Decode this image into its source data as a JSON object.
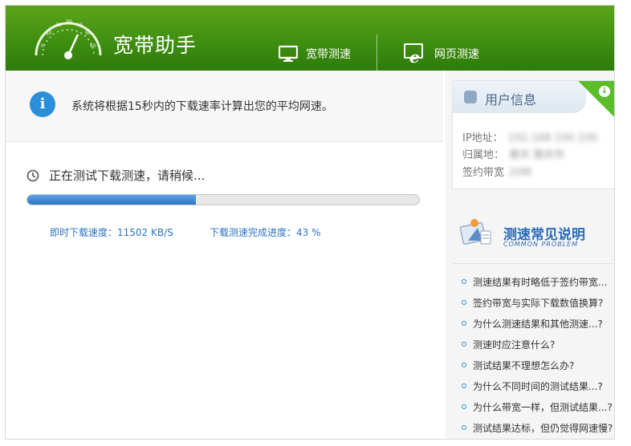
{
  "header": {
    "app_title": "宽带助手",
    "nav": [
      {
        "label": "宽带测速",
        "icon": "monitor-icon"
      },
      {
        "label": "网页测速",
        "icon": "ie-icon"
      }
    ]
  },
  "main": {
    "notice": "系统将根据15秒内的下载速率计算出您的平均网速。",
    "status": "正在测试下载测速，请稍候...",
    "progress_fraction": 0.43,
    "speed_label": "即时下载速度：11502 KB/S",
    "progress_label": "下载测速完成进度：43 %"
  },
  "sidebar": {
    "user_info": {
      "title": "用户信息",
      "rows": [
        {
          "label": "IP地址：",
          "value": "192.168.100.100"
        },
        {
          "label": "归属地：",
          "value": "重庆 重庆市"
        },
        {
          "label": "签约带宽",
          "value": "20M"
        }
      ]
    },
    "faq": {
      "title": "测速常见说明",
      "subtitle": "COMMON PROBLEM",
      "items": [
        "测速结果有时略低于签约带宽...",
        "签约带宽与实际下载数值换算?",
        "为什么测速结果和其他测速...?",
        "测速时应注意什么?",
        "测试结果不理想怎么办?",
        "为什么不同时间的测试结果...?",
        "为什么带宽一样，但测试结果...?",
        "测试结果达标，但仍觉得网速慢?"
      ]
    }
  },
  "colors": {
    "header_green": "#3f8f10",
    "accent_blue": "#2a8fd8",
    "link_blue": "#2b74c2"
  }
}
